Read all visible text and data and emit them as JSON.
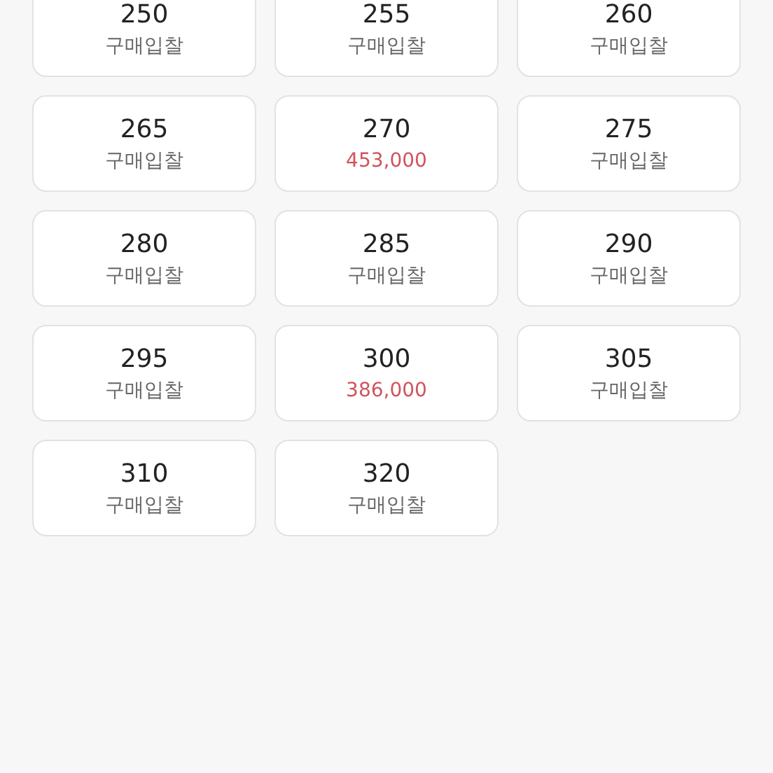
{
  "sizes": [
    {
      "size": "250",
      "kind": "bid",
      "text": "구매입찰"
    },
    {
      "size": "255",
      "kind": "bid",
      "text": "구매입찰"
    },
    {
      "size": "260",
      "kind": "bid",
      "text": "구매입찰"
    },
    {
      "size": "265",
      "kind": "bid",
      "text": "구매입찰"
    },
    {
      "size": "270",
      "kind": "price",
      "text": "453,000"
    },
    {
      "size": "275",
      "kind": "bid",
      "text": "구매입찰"
    },
    {
      "size": "280",
      "kind": "bid",
      "text": "구매입찰"
    },
    {
      "size": "285",
      "kind": "bid",
      "text": "구매입찰"
    },
    {
      "size": "290",
      "kind": "bid",
      "text": "구매입찰"
    },
    {
      "size": "295",
      "kind": "bid",
      "text": "구매입찰"
    },
    {
      "size": "300",
      "kind": "price",
      "text": "386,000"
    },
    {
      "size": "305",
      "kind": "bid",
      "text": "구매입찰"
    },
    {
      "size": "310",
      "kind": "bid",
      "text": "구매입찰"
    },
    {
      "size": "320",
      "kind": "bid",
      "text": "구매입찰"
    }
  ]
}
